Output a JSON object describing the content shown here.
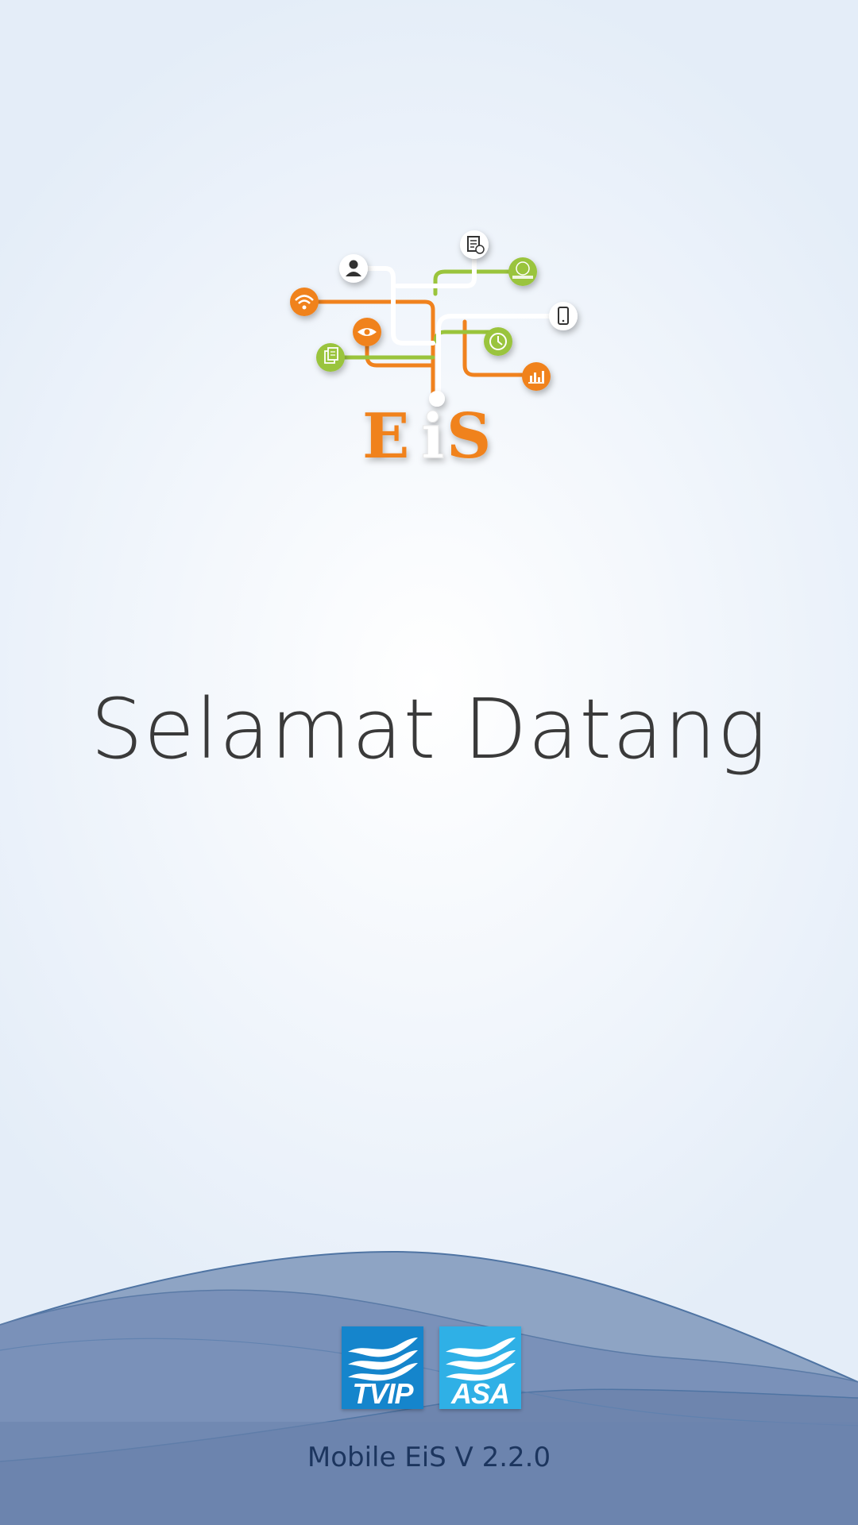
{
  "splash": {
    "logo_text": "EiS",
    "welcome_text": "Selamat Datang",
    "version_text": "Mobile EiS V 2.2.0"
  },
  "brands": [
    {
      "name": "TVIP"
    },
    {
      "name": "ASA"
    }
  ],
  "logo_icons": [
    "person-icon",
    "document-check-icon",
    "service-icon",
    "wifi-icon",
    "mobile-phone-icon",
    "eye-icon",
    "clock-icon",
    "files-icon",
    "bar-chart-icon"
  ],
  "colors": {
    "logo_orange": "#f0821e",
    "logo_green": "#9ac43c",
    "text_dark": "#3a3a3a",
    "wave_blue": "#6d84ad",
    "brand_dark_blue": "#1585cc",
    "brand_light_blue": "#2fb0e6",
    "version_text": "#1c355e"
  }
}
